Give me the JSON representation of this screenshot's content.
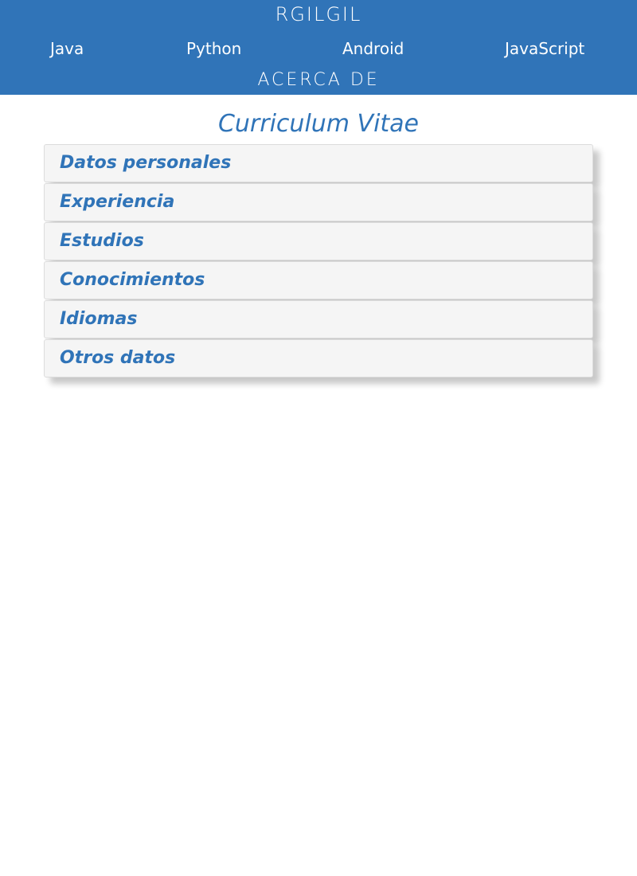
{
  "colors": {
    "header_bg": "#3074b8",
    "accent": "#3074b8",
    "section_bg": "#f5f5f5"
  },
  "header": {
    "brand": "RGILGIL",
    "nav": [
      {
        "label": "Java"
      },
      {
        "label": "Python"
      },
      {
        "label": "Android"
      },
      {
        "label": "JavaScript"
      }
    ],
    "about": "ACERCA DE"
  },
  "main": {
    "title": "Curriculum Vitae",
    "sections": [
      {
        "label": "Datos personales"
      },
      {
        "label": "Experiencia"
      },
      {
        "label": "Estudios"
      },
      {
        "label": "Conocimientos"
      },
      {
        "label": "Idiomas"
      },
      {
        "label": "Otros datos"
      }
    ]
  }
}
